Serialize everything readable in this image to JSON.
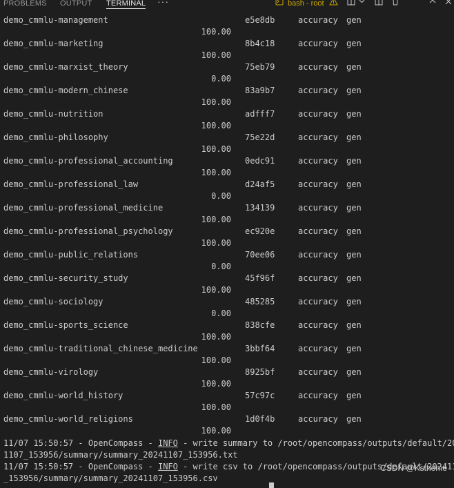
{
  "panel": {
    "tabs": [
      {
        "label": "PROBLEMS",
        "active": false
      },
      {
        "label": "OUTPUT",
        "active": false
      },
      {
        "label": "TERMINAL",
        "active": true
      }
    ],
    "terminal_name": "bash - root",
    "icons": [
      "more-icon",
      "terminal-icon",
      "warning-icon",
      "split-icon",
      "chevron-down-icon",
      "maximize-icon",
      "trash-icon",
      "chevron-up-icon",
      "close-icon"
    ]
  },
  "rows": [
    {
      "name": "demo_cmmlu-management",
      "version": "e5e8db",
      "metric": "accuracy",
      "mode": "gen",
      "score": "100.00"
    },
    {
      "name": "demo_cmmlu-marketing",
      "version": "8b4c18",
      "metric": "accuracy",
      "mode": "gen",
      "score": "100.00"
    },
    {
      "name": "demo_cmmlu-marxist_theory",
      "version": "75eb79",
      "metric": "accuracy",
      "mode": "gen",
      "score": "0.00"
    },
    {
      "name": "demo_cmmlu-modern_chinese",
      "version": "83a9b7",
      "metric": "accuracy",
      "mode": "gen",
      "score": "100.00"
    },
    {
      "name": "demo_cmmlu-nutrition",
      "version": "adfff7",
      "metric": "accuracy",
      "mode": "gen",
      "score": "100.00"
    },
    {
      "name": "demo_cmmlu-philosophy",
      "version": "75e22d",
      "metric": "accuracy",
      "mode": "gen",
      "score": "100.00"
    },
    {
      "name": "demo_cmmlu-professional_accounting",
      "version": "0edc91",
      "metric": "accuracy",
      "mode": "gen",
      "score": "100.00"
    },
    {
      "name": "demo_cmmlu-professional_law",
      "version": "d24af5",
      "metric": "accuracy",
      "mode": "gen",
      "score": "0.00"
    },
    {
      "name": "demo_cmmlu-professional_medicine",
      "version": "134139",
      "metric": "accuracy",
      "mode": "gen",
      "score": "100.00"
    },
    {
      "name": "demo_cmmlu-professional_psychology",
      "version": "ec920e",
      "metric": "accuracy",
      "mode": "gen",
      "score": "100.00"
    },
    {
      "name": "demo_cmmlu-public_relations",
      "version": "70ee06",
      "metric": "accuracy",
      "mode": "gen",
      "score": "0.00"
    },
    {
      "name": "demo_cmmlu-security_study",
      "version": "45f96f",
      "metric": "accuracy",
      "mode": "gen",
      "score": "100.00"
    },
    {
      "name": "demo_cmmlu-sociology",
      "version": "485285",
      "metric": "accuracy",
      "mode": "gen",
      "score": "0.00"
    },
    {
      "name": "demo_cmmlu-sports_science",
      "version": "838cfe",
      "metric": "accuracy",
      "mode": "gen",
      "score": "100.00"
    },
    {
      "name": "demo_cmmlu-traditional_chinese_medicine",
      "version": "3bbf64",
      "metric": "accuracy",
      "mode": "gen",
      "score": "100.00"
    },
    {
      "name": "demo_cmmlu-virology",
      "version": "8925bf",
      "metric": "accuracy",
      "mode": "gen",
      "score": "100.00"
    },
    {
      "name": "demo_cmmlu-world_history",
      "version": "57c97c",
      "metric": "accuracy",
      "mode": "gen",
      "score": "100.00"
    },
    {
      "name": "demo_cmmlu-world_religions",
      "version": "1d0f4b",
      "metric": "accuracy",
      "mode": "gen",
      "score": "100.00"
    }
  ],
  "log": [
    {
      "prefix": "11/07 15:50:57 - OpenCompass - ",
      "level": "INFO",
      "suffix": " - write summary to /root/opencompass/outputs/default/2024",
      "continuation": "1107_153956/summary/summary_20241107_153956.txt"
    },
    {
      "prefix": "11/07 15:50:57 - OpenCompass - ",
      "level": "INFO",
      "suffix": " - write csv to /root/opencompass/outputs/default/20241107",
      "continuation": "_153956/summary/summary_20241107_153956.csv"
    }
  ],
  "watermark": "CSDN @Kstheme",
  "colors": {
    "background": "#1e1e1e",
    "text": "#cccccc",
    "active_tab": "#e7e7e7",
    "warning": "#cca700"
  }
}
